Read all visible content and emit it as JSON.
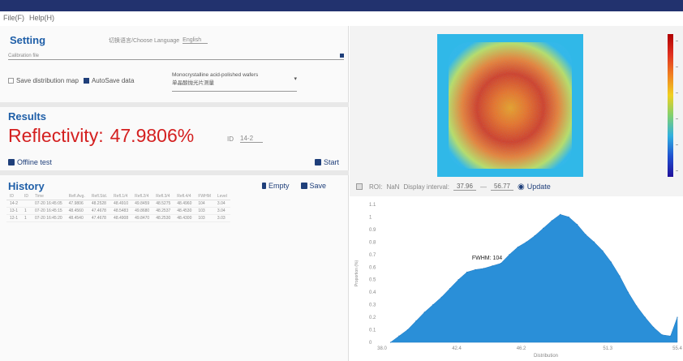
{
  "window": {
    "menu": [
      "File(F)",
      "Help(H)"
    ]
  },
  "setting": {
    "title": "Setting",
    "language_label": "切换语言/Choose Language",
    "language_value": "English",
    "calibration_label": "Calibration file",
    "save_distribution_label": "Save distribution map",
    "save_distribution_checked": false,
    "autosave_label": "AutoSave data",
    "autosave_checked": true,
    "sample_select_line1": "Monocrystalline acid-polished wafers",
    "sample_select_line2": "单晶酸抛光片测量"
  },
  "results": {
    "title": "Results",
    "reflectivity_label": "Reflectivity:",
    "reflectivity_value": "47.9806%",
    "id_label": "ID",
    "id_value": "14-2",
    "offline_test_label": "Offline test",
    "start_label": "Start"
  },
  "history": {
    "title": "History",
    "empty_label": "Empty",
    "save_label": "Save",
    "columns": [
      "ID",
      "ID",
      "Time",
      "Refl.Avg.",
      "Refl.Std.",
      "Refl.1/4",
      "Refl.2/4",
      "Refl.3/4",
      "Refl.4/4",
      "FWHM",
      "Level"
    ],
    "rows": [
      [
        "14-2",
        "",
        "07-20 16:45:05",
        "47.9806",
        "48.2528",
        "48.4910",
        "49.8459",
        "48.5275",
        "48.4960",
        "104",
        "3.04"
      ],
      [
        "13-1",
        "1",
        "07-20 16:45:15",
        "48.4560",
        "47.4678",
        "48.5483",
        "49.8680",
        "48.2537",
        "48.4530",
        "103",
        "3.04"
      ],
      [
        "12-1",
        "1",
        "07-20 16:45:20",
        "48.4540",
        "47.4678",
        "48.4908",
        "49.8470",
        "48.2530",
        "48.4300",
        "103",
        "3.03"
      ]
    ]
  },
  "map_controls": {
    "roi_label": "ROI:",
    "roi_value": "NaN",
    "interval_label": "Display interval:",
    "interval_min": "37.96",
    "interval_sep": "—",
    "interval_max": "56.77",
    "update_label": "Update"
  },
  "colors": {
    "accent": "#1f5fa8",
    "title_bar": "#22326e",
    "reflectivity": "#d42020",
    "histogram": "#2a8fd8"
  },
  "chart_data": {
    "type": "area",
    "title": "",
    "xlabel": "Distribution",
    "ylabel": "Proportion (%)",
    "annotation": "FWHM: 104",
    "x_ticks": [
      "38.0",
      "42.4",
      "46.2",
      "51.3",
      "55.4"
    ],
    "y_ticks": [
      "0",
      "0.1",
      "0.2",
      "0.3",
      "0.4",
      "0.5",
      "0.6",
      "0.7",
      "0.8",
      "0.9",
      "1",
      "1.1"
    ],
    "xlim": [
      38.0,
      55.4
    ],
    "ylim": [
      0,
      1.1
    ],
    "x": [
      38.5,
      39.0,
      39.5,
      40.0,
      40.5,
      41.0,
      41.5,
      42.0,
      42.5,
      43.0,
      43.5,
      44.0,
      44.5,
      45.0,
      45.5,
      46.0,
      46.5,
      47.0,
      47.5,
      48.0,
      48.5,
      49.0,
      49.5,
      50.0,
      50.5,
      51.0,
      51.5,
      52.0,
      52.5,
      53.0,
      53.5,
      54.0,
      54.5,
      55.0,
      55.4
    ],
    "values": [
      0.0,
      0.05,
      0.1,
      0.17,
      0.24,
      0.3,
      0.36,
      0.43,
      0.5,
      0.56,
      0.58,
      0.59,
      0.61,
      0.63,
      0.7,
      0.76,
      0.8,
      0.85,
      0.91,
      0.97,
      1.02,
      1.0,
      0.94,
      0.86,
      0.8,
      0.73,
      0.64,
      0.53,
      0.4,
      0.29,
      0.2,
      0.12,
      0.06,
      0.05,
      0.2
    ]
  }
}
